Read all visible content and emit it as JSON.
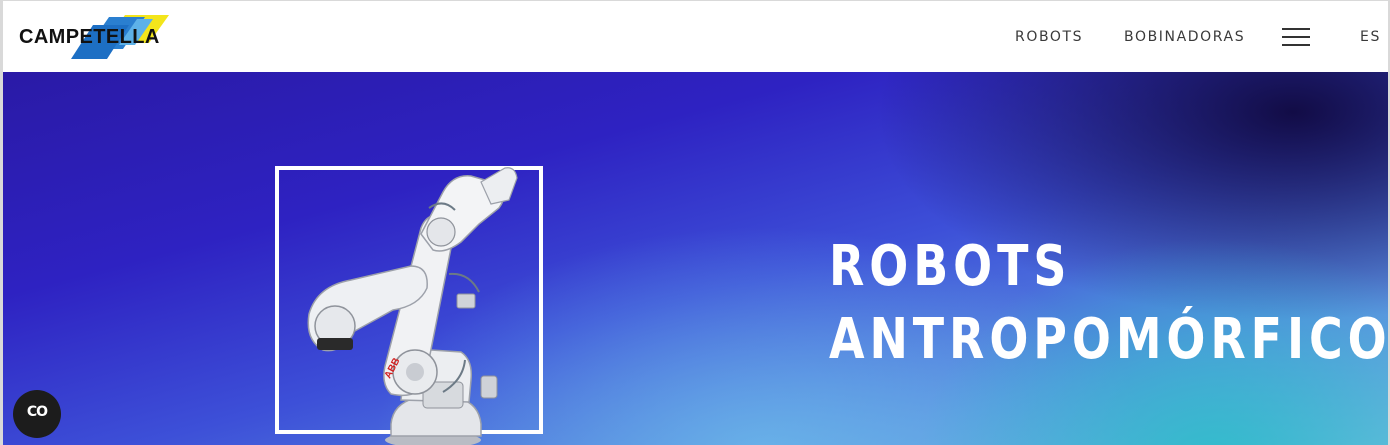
{
  "brand": {
    "logo_text": "CAMPETELLA",
    "colors": {
      "blue": "#1d6fc4",
      "yellow": "#f3e51b",
      "text": "#111111"
    }
  },
  "nav": {
    "items": [
      {
        "label": "ROBOTS"
      },
      {
        "label": "BOBINADORAS"
      }
    ],
    "menu_icon": "hamburger-menu-icon",
    "language": "ES"
  },
  "hero": {
    "title_line1": "ROBOTS",
    "title_line2": "ANTROPOMÓRFICOS",
    "robot_brand": "ABB",
    "colors": {
      "deep": "#2a1aa6",
      "mid": "#3d50d8",
      "light": "#6fb9e0",
      "teal": "#28bec8"
    }
  },
  "cookie_button": {
    "icon": "cookie-settings-icon",
    "glyph": "CO"
  }
}
